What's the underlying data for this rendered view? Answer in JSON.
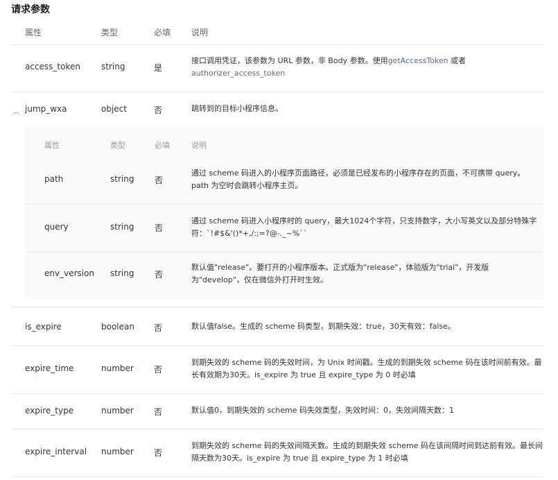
{
  "section_title": "请求参数",
  "headers": {
    "attr": "属性",
    "type": "类型",
    "required": "必填",
    "desc": "说明"
  },
  "rows": [
    {
      "name": "access_token",
      "type": "string",
      "required": "是",
      "desc_before": "接口调用凭证，该参数为 URL 参数，非 Body 参数。使用",
      "link1": "getAccessToken",
      "desc_mid": " 或者 ",
      "link2": "authorizer_access_token"
    },
    {
      "name": "jump_wxa",
      "type": "object",
      "required": "否",
      "desc": "跳转到的目标小程序信息。"
    },
    {
      "name": "is_expire",
      "type": "boolean",
      "required": "否",
      "desc": "默认值false。生成的 scheme 码类型，到期失效：true，30天有效：false。"
    },
    {
      "name": "expire_time",
      "type": "number",
      "required": "否",
      "desc": "到期失效的 scheme 码的失效时间，为 Unix 时间戳。生成的到期失效 scheme 码在该时间前有效。最长有效期为30天。is_expire 为 true 且 expire_type 为 0 时必填"
    },
    {
      "name": "expire_type",
      "type": "number",
      "required": "否",
      "desc": "默认值0，到期失效的 scheme 码失效类型，失效时间：0，失效间隔天数：1"
    },
    {
      "name": "expire_interval",
      "type": "number",
      "required": "否",
      "desc": "到期失效的 scheme 码的失效间隔天数。生成的到期失效 scheme 码在该间隔时间到达前有效。最长间隔天数为30天。is_expire 为 true 且 expire_type 为 1 时必填"
    }
  ],
  "nested": {
    "headers": {
      "attr": "属性",
      "type": "类型",
      "required": "必填",
      "desc": "说明"
    },
    "rows": [
      {
        "name": "path",
        "type": "string",
        "required": "否",
        "desc": "通过 scheme 码进入的小程序页面路径，必须是已经发布的小程序存在的页面，不可携带 query。path 为空时会跳转小程序主页。"
      },
      {
        "name": "query",
        "type": "string",
        "required": "否",
        "desc": "通过 scheme 码进入小程序时的 query，最大1024个字符，只支持数字，大小写英文以及部分特殊字符：`!#$&'()*+,/:;=?@-._~%``"
      },
      {
        "name": "env_version",
        "type": "string",
        "required": "否",
        "desc": "默认值\"release\"。要打开的小程序版本。正式版为\"release\"，体验版为\"trial\"，开发版为\"develop\"，仅在微信外打开时生效。"
      }
    ]
  }
}
